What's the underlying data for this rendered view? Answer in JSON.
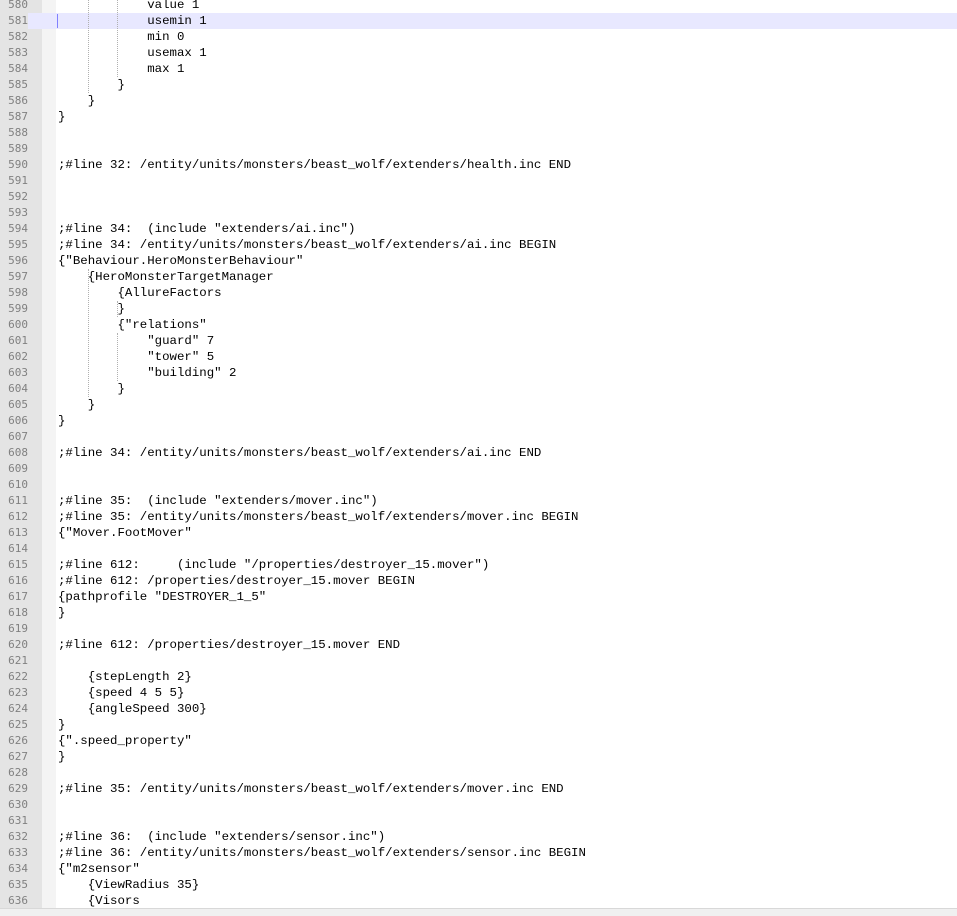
{
  "editor": {
    "current_line": "581",
    "lines": [
      {
        "n": "580",
        "text": "            value 1"
      },
      {
        "n": "581",
        "text": "            usemin 1"
      },
      {
        "n": "582",
        "text": "            min 0"
      },
      {
        "n": "583",
        "text": "            usemax 1"
      },
      {
        "n": "584",
        "text": "            max 1"
      },
      {
        "n": "585",
        "text": "        }"
      },
      {
        "n": "586",
        "text": "    }"
      },
      {
        "n": "587",
        "text": "}"
      },
      {
        "n": "588",
        "text": ""
      },
      {
        "n": "589",
        "text": ""
      },
      {
        "n": "590",
        "text": ";#line 32: /entity/units/monsters/beast_wolf/extenders/health.inc END"
      },
      {
        "n": "591",
        "text": ""
      },
      {
        "n": "592",
        "text": ""
      },
      {
        "n": "593",
        "text": ""
      },
      {
        "n": "594",
        "text": ";#line 34:  (include \"extenders/ai.inc\")"
      },
      {
        "n": "595",
        "text": ";#line 34: /entity/units/monsters/beast_wolf/extenders/ai.inc BEGIN"
      },
      {
        "n": "596",
        "text": "{\"Behaviour.HeroMonsterBehaviour\""
      },
      {
        "n": "597",
        "text": "    {HeroMonsterTargetManager"
      },
      {
        "n": "598",
        "text": "        {AllureFactors"
      },
      {
        "n": "599",
        "text": "        }"
      },
      {
        "n": "600",
        "text": "        {\"relations\""
      },
      {
        "n": "601",
        "text": "            \"guard\" 7"
      },
      {
        "n": "602",
        "text": "            \"tower\" 5"
      },
      {
        "n": "603",
        "text": "            \"building\" 2"
      },
      {
        "n": "604",
        "text": "        }"
      },
      {
        "n": "605",
        "text": "    }"
      },
      {
        "n": "606",
        "text": "}"
      },
      {
        "n": "607",
        "text": ""
      },
      {
        "n": "608",
        "text": ";#line 34: /entity/units/monsters/beast_wolf/extenders/ai.inc END"
      },
      {
        "n": "609",
        "text": ""
      },
      {
        "n": "610",
        "text": ""
      },
      {
        "n": "611",
        "text": ";#line 35:  (include \"extenders/mover.inc\")"
      },
      {
        "n": "612",
        "text": ";#line 35: /entity/units/monsters/beast_wolf/extenders/mover.inc BEGIN"
      },
      {
        "n": "613",
        "text": "{\"Mover.FootMover\""
      },
      {
        "n": "614",
        "text": ""
      },
      {
        "n": "615",
        "text": ";#line 612:     (include \"/properties/destroyer_15.mover\")"
      },
      {
        "n": "616",
        "text": ";#line 612: /properties/destroyer_15.mover BEGIN"
      },
      {
        "n": "617",
        "text": "{pathprofile \"DESTROYER_1_5\""
      },
      {
        "n": "618",
        "text": "}"
      },
      {
        "n": "619",
        "text": ""
      },
      {
        "n": "620",
        "text": ";#line 612: /properties/destroyer_15.mover END"
      },
      {
        "n": "621",
        "text": ""
      },
      {
        "n": "622",
        "text": "    {stepLength 2}"
      },
      {
        "n": "623",
        "text": "    {speed 4 5 5}"
      },
      {
        "n": "624",
        "text": "    {angleSpeed 300}"
      },
      {
        "n": "625",
        "text": "}"
      },
      {
        "n": "626",
        "text": "{\".speed_property\""
      },
      {
        "n": "627",
        "text": "}"
      },
      {
        "n": "628",
        "text": ""
      },
      {
        "n": "629",
        "text": ";#line 35: /entity/units/monsters/beast_wolf/extenders/mover.inc END"
      },
      {
        "n": "630",
        "text": ""
      },
      {
        "n": "631",
        "text": ""
      },
      {
        "n": "632",
        "text": ";#line 36:  (include \"extenders/sensor.inc\")"
      },
      {
        "n": "633",
        "text": ";#line 36: /entity/units/monsters/beast_wolf/extenders/sensor.inc BEGIN"
      },
      {
        "n": "634",
        "text": "{\"m2sensor\""
      },
      {
        "n": "635",
        "text": "    {ViewRadius 35}"
      },
      {
        "n": "636",
        "text": "    {Visors"
      }
    ]
  },
  "colors": {
    "gutter_bg": "#e4e4e4",
    "current_line_bg": "#e8e8ff",
    "line_number": "#808080",
    "text": "#000000",
    "indent_guide": "#b0b0b0"
  }
}
